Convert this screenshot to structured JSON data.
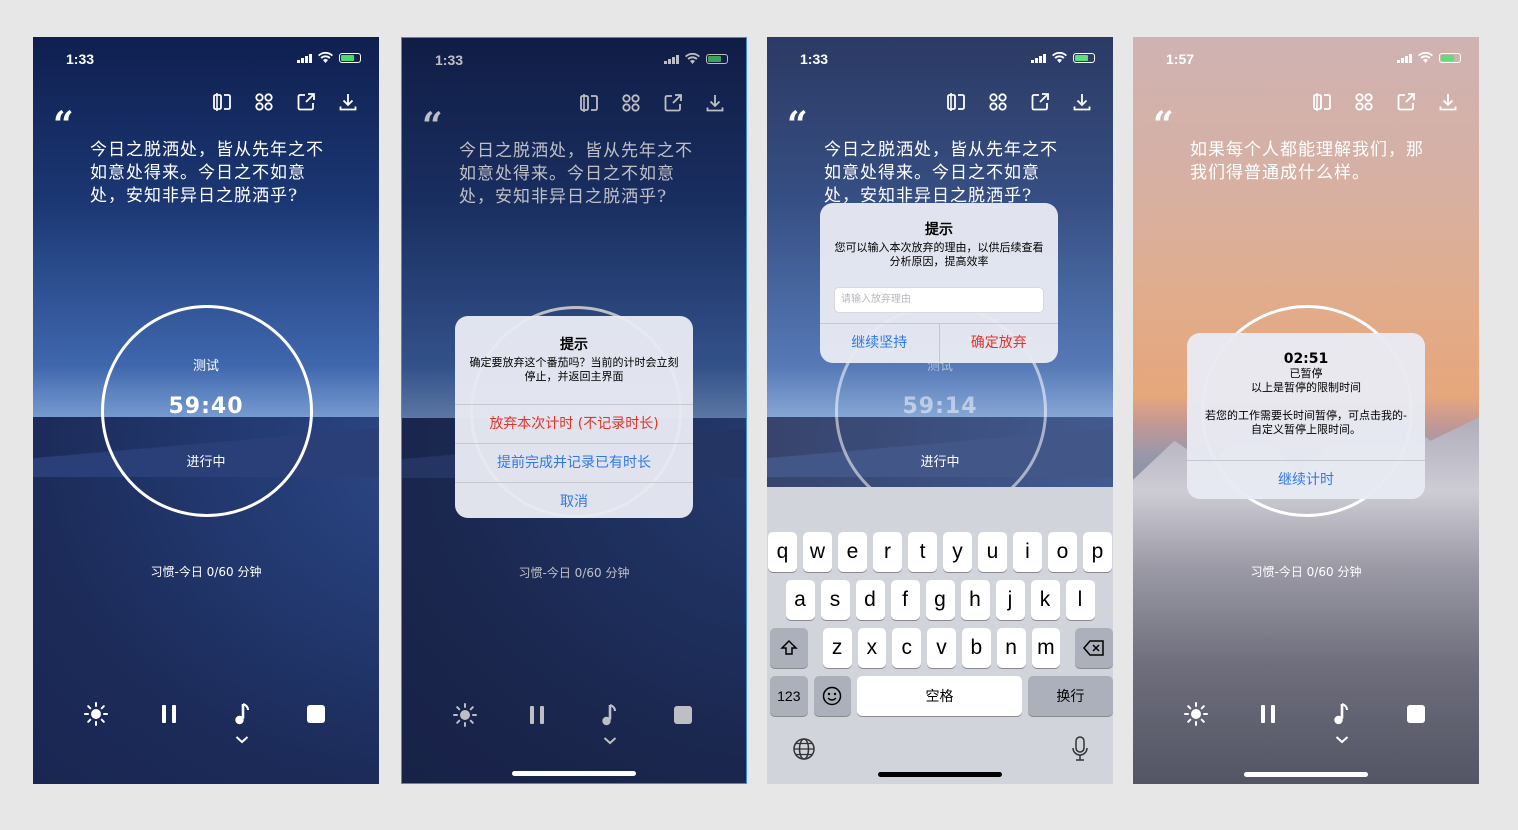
{
  "status": {
    "time_a": "1:33",
    "time_b": "1:57"
  },
  "toolbar": {
    "icons": [
      "mirror-icon",
      "grid-icon",
      "share-icon",
      "download-icon"
    ]
  },
  "quote": {
    "mark": "“",
    "text1": "今日之脱洒处，皆从先年之不如意处得来。今日之不如意处，安知非异日之脱洒乎?",
    "text2": "如果每个人都能理解我们，那我们得普通成什么样。"
  },
  "timer": {
    "task": "测试",
    "time_a": "59:40",
    "time_b": "59:14",
    "state": "进行中"
  },
  "habit": "习惯-今日 0/60 分钟",
  "controls": [
    "brightness-icon",
    "pause-icon",
    "music-icon",
    "stop-icon"
  ],
  "alert_abandon": {
    "title": "提示",
    "message": "确定要放弃这个番茄吗？当前的计时会立刻停止，并返回主界面",
    "btn_abandon": "放弃本次计时 (不记录时长)",
    "btn_finish": "提前完成并记录已有时长",
    "btn_cancel": "取消"
  },
  "alert_reason": {
    "title": "提示",
    "message": "您可以输入本次放弃的理由，以供后续查看分析原因，提高效率",
    "placeholder": "请输入放弃理由",
    "btn_keep": "继续坚持",
    "btn_confirm": "确定放弃"
  },
  "alert_paused": {
    "time": "02:51",
    "line1": "已暂停",
    "line2": "以上是暂停的限制时间",
    "message": "若您的工作需要长时间暂停，可点击我的-自定义暂停上限时间。",
    "btn_continue": "继续计时"
  },
  "keyboard": {
    "row1": [
      "q",
      "w",
      "e",
      "r",
      "t",
      "y",
      "u",
      "i",
      "o",
      "p"
    ],
    "row2": [
      "a",
      "s",
      "d",
      "f",
      "g",
      "h",
      "j",
      "k",
      "l"
    ],
    "row3": [
      "z",
      "x",
      "c",
      "v",
      "b",
      "n",
      "m"
    ],
    "num": "123",
    "space": "空格",
    "return": "换行"
  },
  "colors": {
    "accent_blue": "#2f7ae5",
    "destructive_red": "#e5332a",
    "battery_green": "#4cd964",
    "selection_border": "#3b8ee6"
  }
}
